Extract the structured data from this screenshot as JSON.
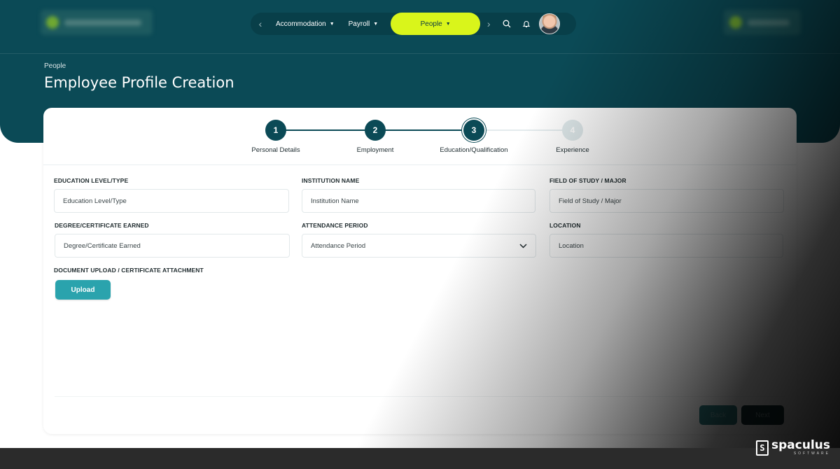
{
  "header": {
    "nav": {
      "items": [
        {
          "label": "Accommodation"
        },
        {
          "label": "Payroll"
        },
        {
          "label": "People"
        }
      ],
      "prev_icon": "chevron-left-icon",
      "next_icon": "chevron-right-icon",
      "search_icon": "search-icon",
      "bell_icon": "bell-icon"
    }
  },
  "page": {
    "breadcrumb": "People",
    "title": "Employee Profile Creation"
  },
  "stepper": {
    "steps": [
      {
        "number": "1",
        "label": "Personal Details",
        "status": "done"
      },
      {
        "number": "2",
        "label": "Employment",
        "status": "done"
      },
      {
        "number": "3",
        "label": "Education/Qualification",
        "status": "current"
      },
      {
        "number": "4",
        "label": "Experience",
        "status": "pending"
      }
    ]
  },
  "form": {
    "education_level": {
      "label": "EDUCATION LEVEL/TYPE",
      "placeholder": "Education Level/Type"
    },
    "institution": {
      "label": "INSTITUTION NAME",
      "placeholder": "Institution Name"
    },
    "field_of_study": {
      "label": "FIELD OF STUDY / MAJOR",
      "placeholder": "Field of Study / Major"
    },
    "degree": {
      "label": "DEGREE/CERTIFICATE EARNED",
      "placeholder": "Degree/Certificate Earned"
    },
    "attendance": {
      "label": "ATTENDANCE PERIOD",
      "placeholder": "Attendance Period"
    },
    "location": {
      "label": "LOCATION",
      "placeholder": "Location"
    },
    "document": {
      "label": "DOCUMENT UPLOAD / CERTIFICATE ATTACHMENT",
      "button": "Upload"
    }
  },
  "actions": {
    "back": "Back",
    "next": "Next"
  },
  "brand": {
    "name": "spaculus",
    "sub": "SOFTWARE"
  },
  "colors": {
    "primary": "#0b4a56",
    "accent": "#d9f51b",
    "upload": "#2aa3ad"
  }
}
